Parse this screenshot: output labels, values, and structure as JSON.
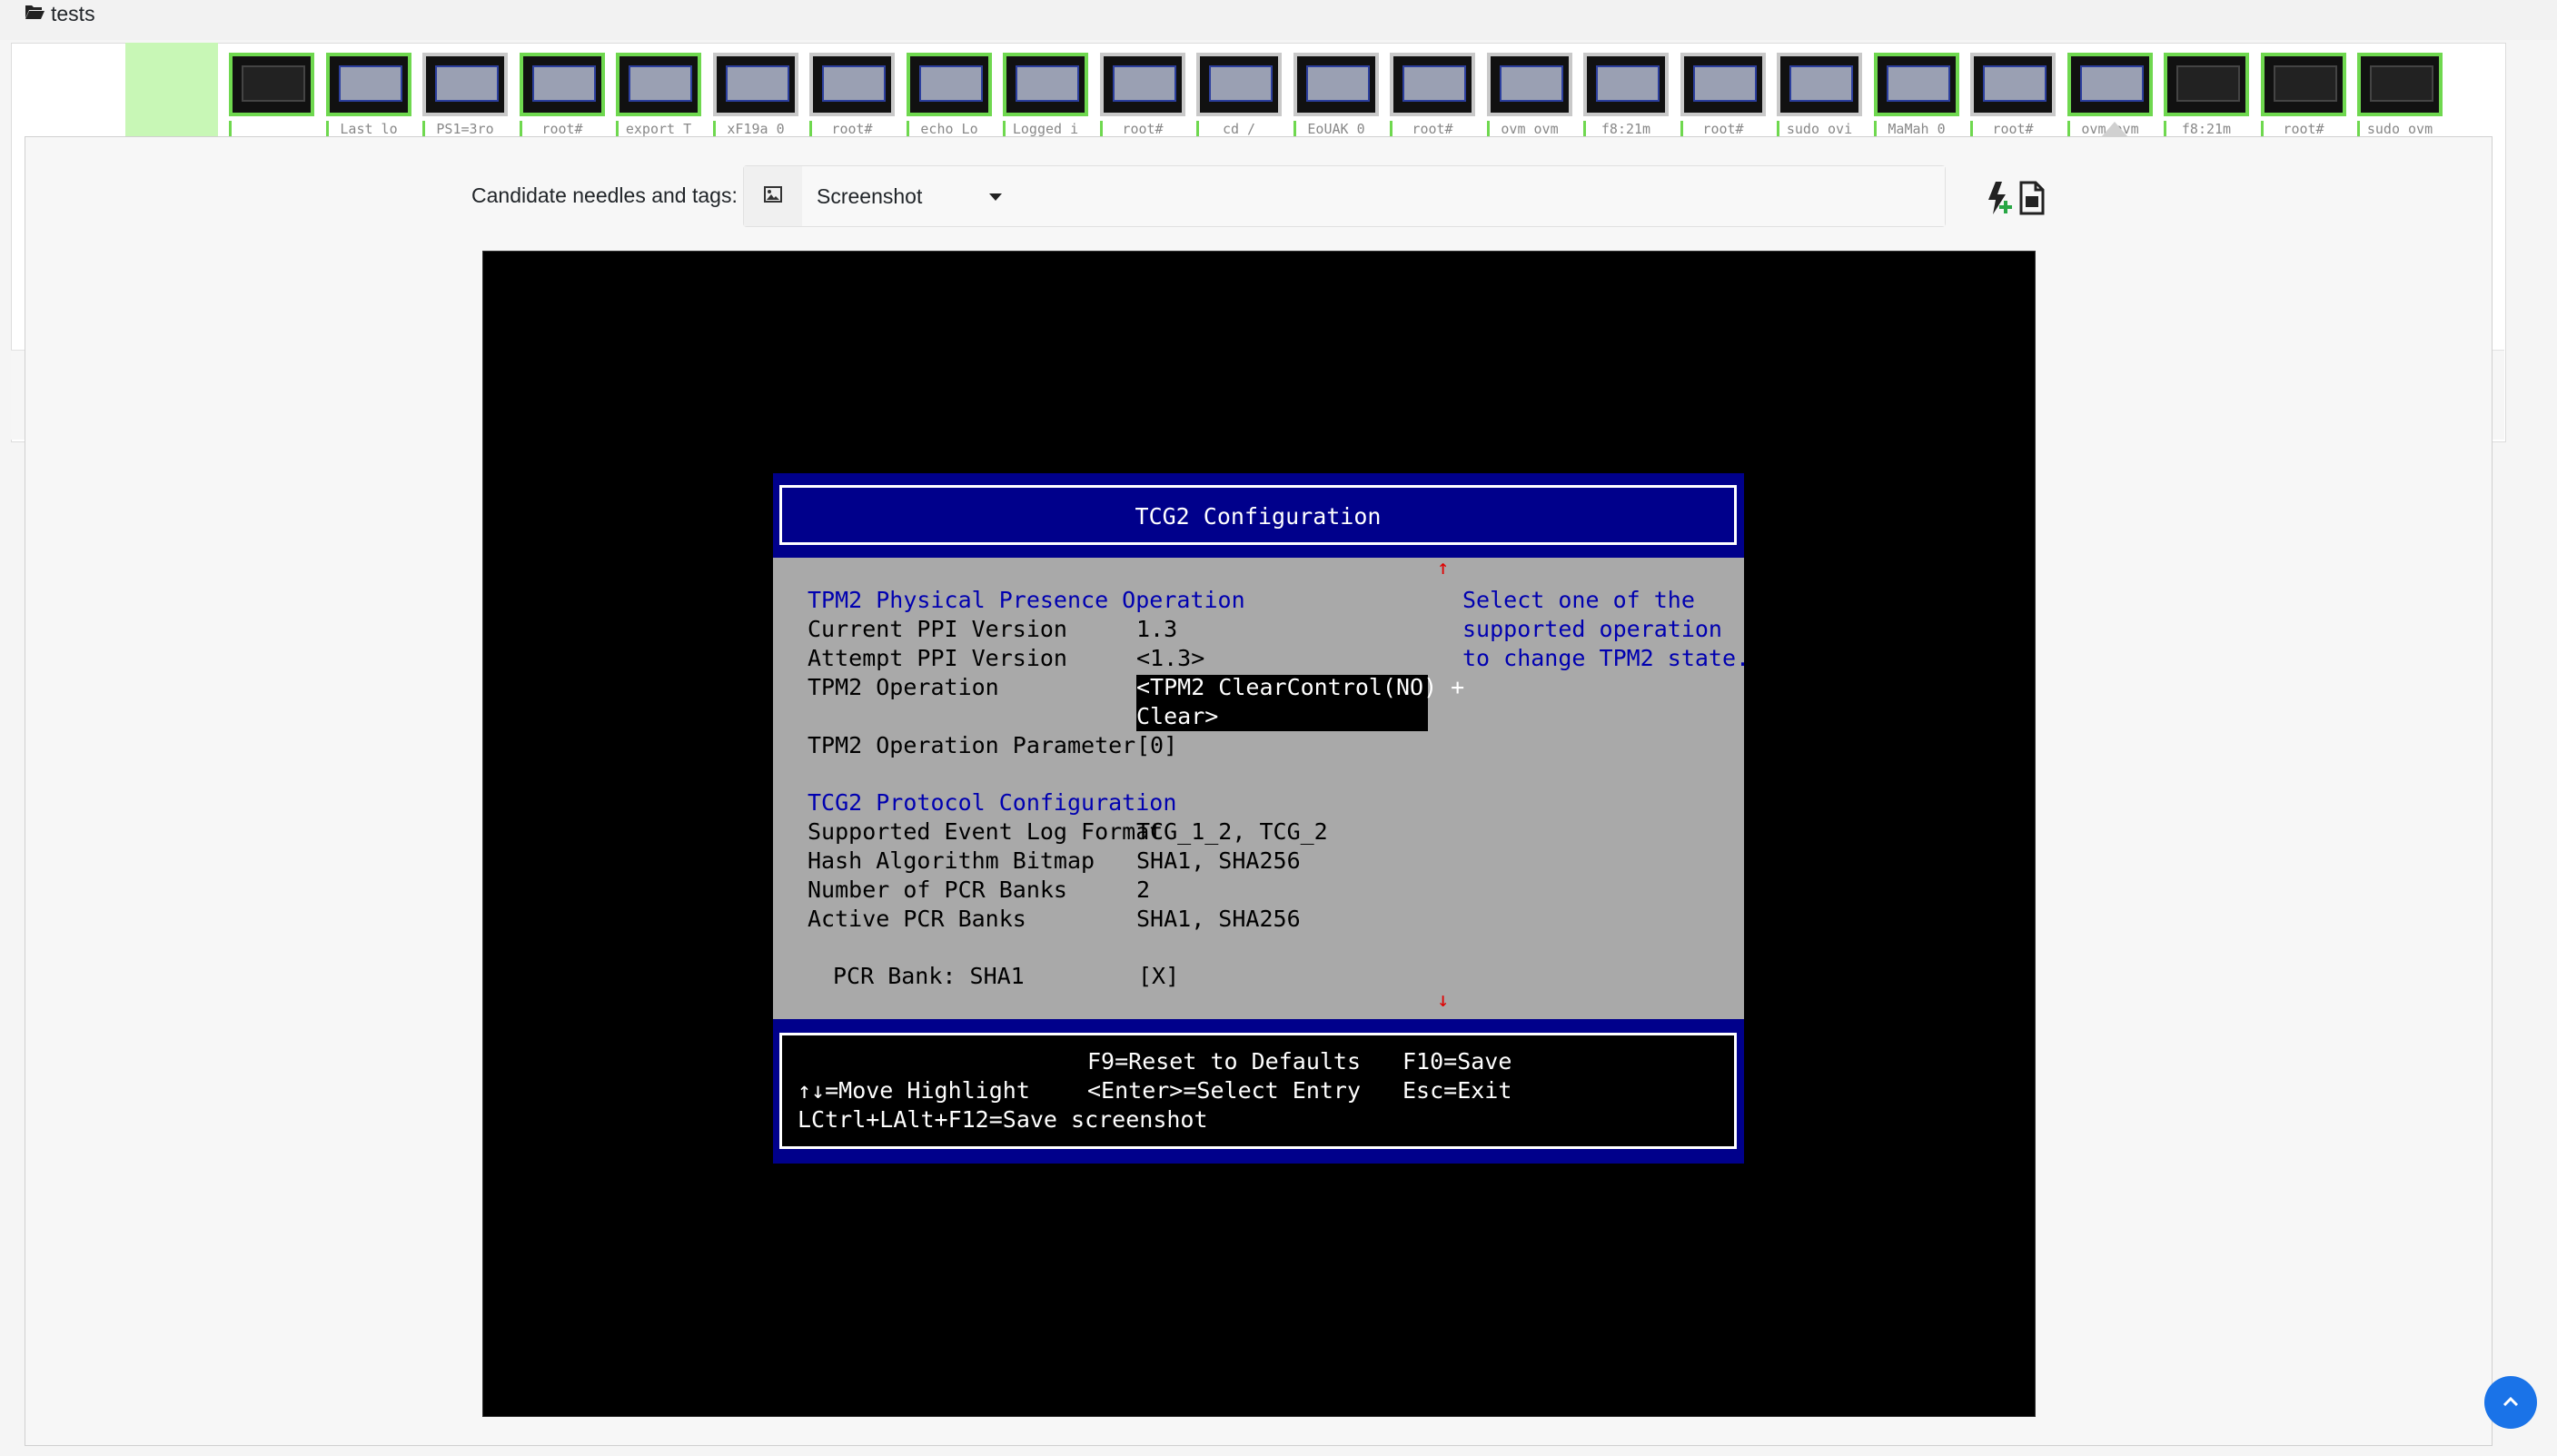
{
  "header": {
    "title": "tests"
  },
  "thumbnails": [
    {
      "label": "_",
      "green": true,
      "dark": true
    },
    {
      "label": "Last lo",
      "green": true
    },
    {
      "label": "PS1=3ro",
      "green": false
    },
    {
      "label": "root#",
      "green": true
    },
    {
      "label": "export T",
      "green": true
    },
    {
      "label": "xF19a 0",
      "green": false
    },
    {
      "label": "root#",
      "green": false
    },
    {
      "label": "echo Lo",
      "green": true
    },
    {
      "label": "Logged i",
      "green": true
    },
    {
      "label": "root#",
      "green": false
    },
    {
      "label": "cd /",
      "green": false
    },
    {
      "label": "EoUAK 0",
      "green": false
    },
    {
      "label": "root#",
      "green": false
    },
    {
      "label": "ovm ovm",
      "green": false
    },
    {
      "label": "f8:21m",
      "green": false
    },
    {
      "label": "root#",
      "green": false
    },
    {
      "label": "sudo ovi",
      "green": false
    },
    {
      "label": "MaMah 0",
      "green": true
    },
    {
      "label": "root#",
      "green": false
    },
    {
      "label": "ovm ovm",
      "green": true
    },
    {
      "label": "f8:21m",
      "green": true,
      "dark": true
    },
    {
      "label": "root#",
      "green": true,
      "dark": true
    },
    {
      "label": "sudo ovm",
      "green": true,
      "dark": true
    }
  ],
  "candidates": {
    "label": "Candidate needles and tags:",
    "selected": "Screenshot"
  },
  "tcg": {
    "title": "TCG2 Configuration",
    "section1": "TPM2 Physical Presence Operation",
    "current_ppi_label": "Current PPI Version",
    "current_ppi_value": "1.3",
    "attempt_ppi_label": "Attempt PPI Version",
    "attempt_ppi_value": "<1.3>",
    "operation_label": "TPM2 Operation",
    "operation_value_line1": "<TPM2 ClearControl(NO) +",
    "operation_value_line2": "Clear>",
    "op_param_label": "TPM2 Operation Parameter",
    "op_param_value": "[0]",
    "section2": "TCG2 Protocol Configuration",
    "event_log_label": "Supported Event Log Format",
    "event_log_value": "TCG_1_2, TCG_2",
    "hash_label": "Hash Algorithm Bitmap",
    "hash_value": "SHA1, SHA256",
    "pcr_banks_label": "Number of PCR Banks",
    "pcr_banks_value": "2",
    "active_pcr_label": "Active PCR Banks",
    "active_pcr_value": "SHA1, SHA256",
    "pcr_sha1_label": "PCR Bank: SHA1",
    "pcr_sha1_value": "[X]",
    "help1": "Select one of the",
    "help2": "supported operation",
    "help3": "to change TPM2 state.",
    "scroll_up": "↑",
    "scroll_down": "↓",
    "foot_f9": "F9=Reset to Defaults",
    "foot_f10": "F10=Save",
    "foot_move": "↑↓=Move Highlight",
    "foot_enter": "<Enter>=Select Entry",
    "foot_esc": "Esc=Exit",
    "foot_save": "LCtrl+LAlt+F12=Save screenshot"
  },
  "colors": {
    "green": "#6fd84f",
    "bios_blue": "#00008b",
    "bios_gray": "#a9a9a9",
    "accent": "#1a73e8"
  }
}
